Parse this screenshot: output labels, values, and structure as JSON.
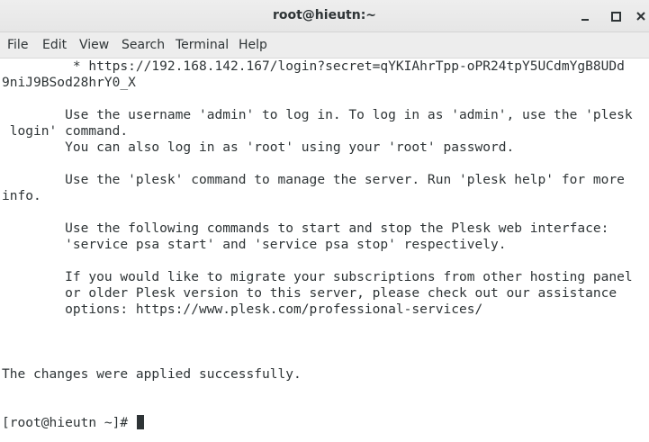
{
  "window": {
    "title": "root@hieutn:~"
  },
  "menu": [
    {
      "label": "File"
    },
    {
      "label": "Edit"
    },
    {
      "label": "View"
    },
    {
      "label": "Search"
    },
    {
      "label": "Terminal"
    },
    {
      "label": "Help"
    }
  ],
  "terminal": {
    "lines": [
      "         * https://192.168.142.167/login?secret=qYKIAhrTpp-oPR24tpY5UCdmYgB8UDd",
      "9niJ9BSod28hrY0_X",
      "",
      "        Use the username 'admin' to log in. To log in as 'admin', use the 'plesk",
      " login' command.",
      "        You can also log in as 'root' using your 'root' password.",
      "",
      "        Use the 'plesk' command to manage the server. Run 'plesk help' for more",
      "info.",
      "",
      "        Use the following commands to start and stop the Plesk web interface:",
      "        'service psa start' and 'service psa stop' respectively.",
      "",
      "        If you would like to migrate your subscriptions from other hosting panel",
      "        or older Plesk version to this server, please check out our assistance",
      "        options: https://www.plesk.com/professional-services/",
      "",
      "",
      "",
      "The changes were applied successfully.",
      "",
      "",
      "[root@hieutn ~]# "
    ]
  },
  "icons": {
    "minimize": "minimize-icon",
    "maximize": "maximize-icon",
    "close": "close-icon"
  }
}
